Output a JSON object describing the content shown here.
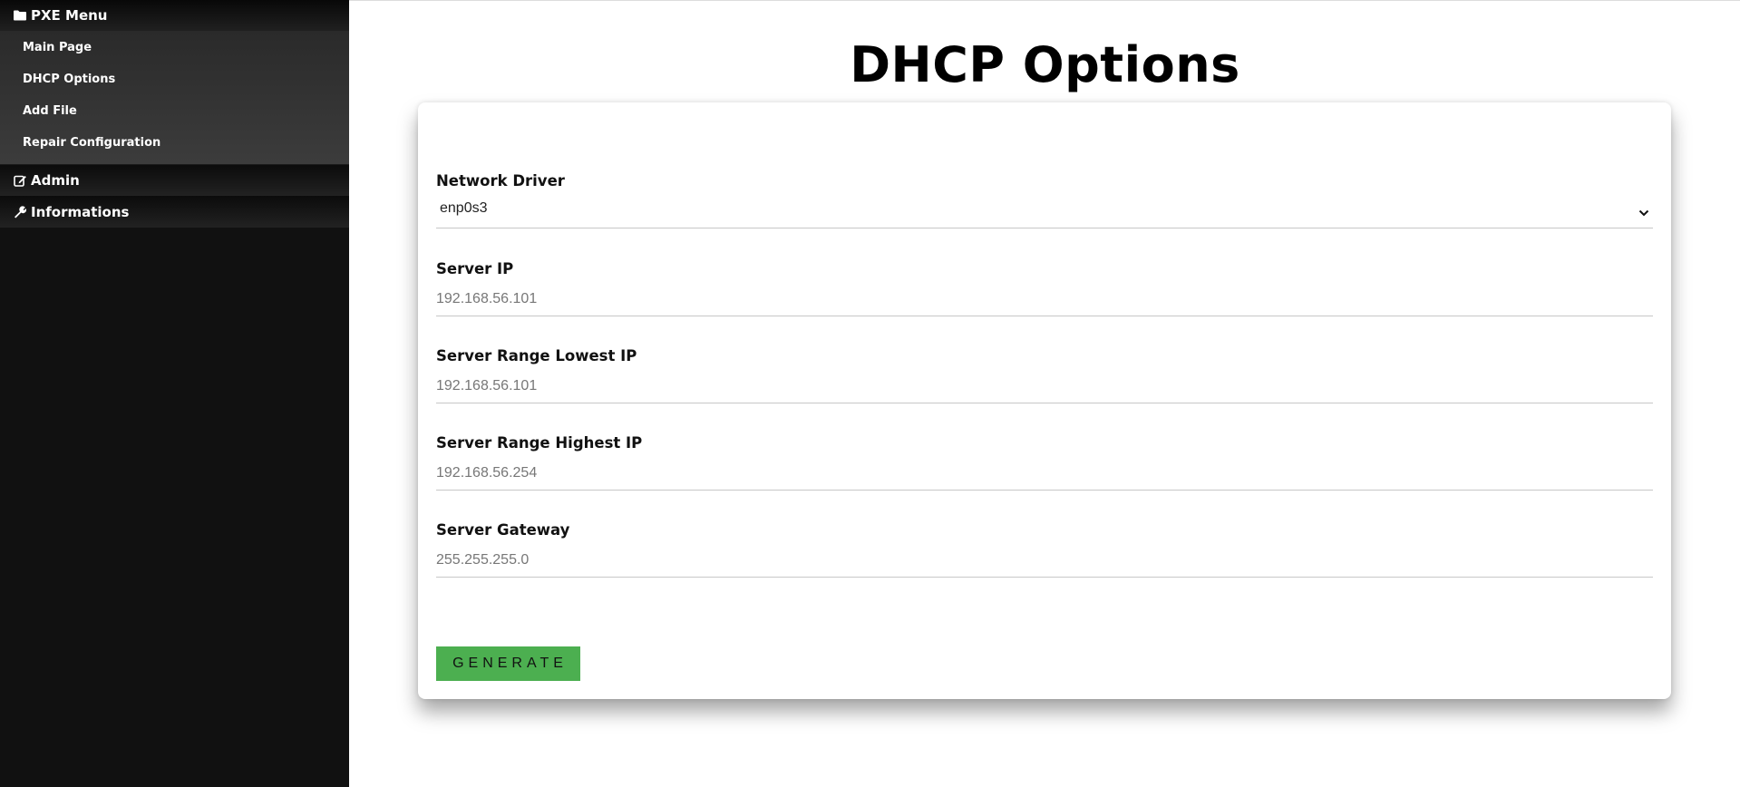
{
  "sidebar": {
    "pxe_menu": {
      "label": "PXE Menu",
      "icon": "folder-icon",
      "items": [
        {
          "label": "Main Page"
        },
        {
          "label": "DHCP Options"
        },
        {
          "label": "Add File"
        },
        {
          "label": "Repair Configuration"
        }
      ]
    },
    "admin": {
      "label": "Admin",
      "icon": "edit-icon"
    },
    "informations": {
      "label": "Informations",
      "icon": "wrench-icon"
    }
  },
  "page": {
    "title": "DHCP Options"
  },
  "form": {
    "network_driver": {
      "label": "Network Driver",
      "value": "enp0s3"
    },
    "server_ip": {
      "label": "Server IP",
      "placeholder": "192.168.56.101"
    },
    "range_low": {
      "label": "Server Range Lowest IP",
      "placeholder": "192.168.56.101"
    },
    "range_high": {
      "label": "Server Range Highest IP",
      "placeholder": "192.168.56.254"
    },
    "gateway": {
      "label": "Server Gateway",
      "placeholder": "255.255.255.0"
    },
    "generate_label": "GENERATE"
  },
  "colors": {
    "sidebar_bg": "#111111",
    "button_bg": "#4caf50"
  }
}
